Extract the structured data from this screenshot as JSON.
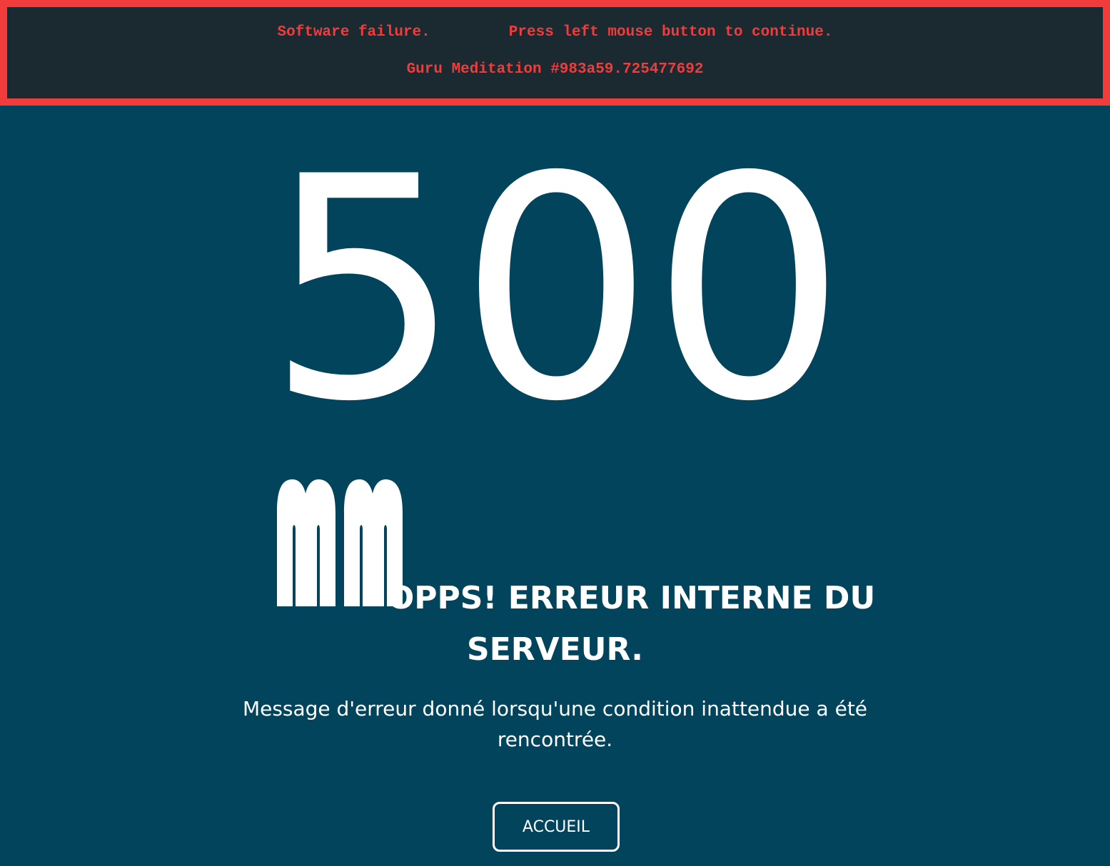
{
  "banner": {
    "left_text": "Software failure.",
    "right_text": "Press left mouse button to continue.",
    "meditation": "Guru Meditation #983a59.725477692",
    "border_color": "#f23c3c",
    "background_color": "#1b2a31"
  },
  "error": {
    "code": "500",
    "title_line1": "OPPS! ERREUR INTERNE DU",
    "title_line2": "SERVEUR.",
    "description": "Message d'erreur donné lorsqu'une condition inattendue a été rencontrée.",
    "icon": "face-icon"
  },
  "actions": {
    "home_label": "ACCUEIL"
  },
  "colors": {
    "page_background": "#02445c",
    "text": "#ffffff"
  }
}
